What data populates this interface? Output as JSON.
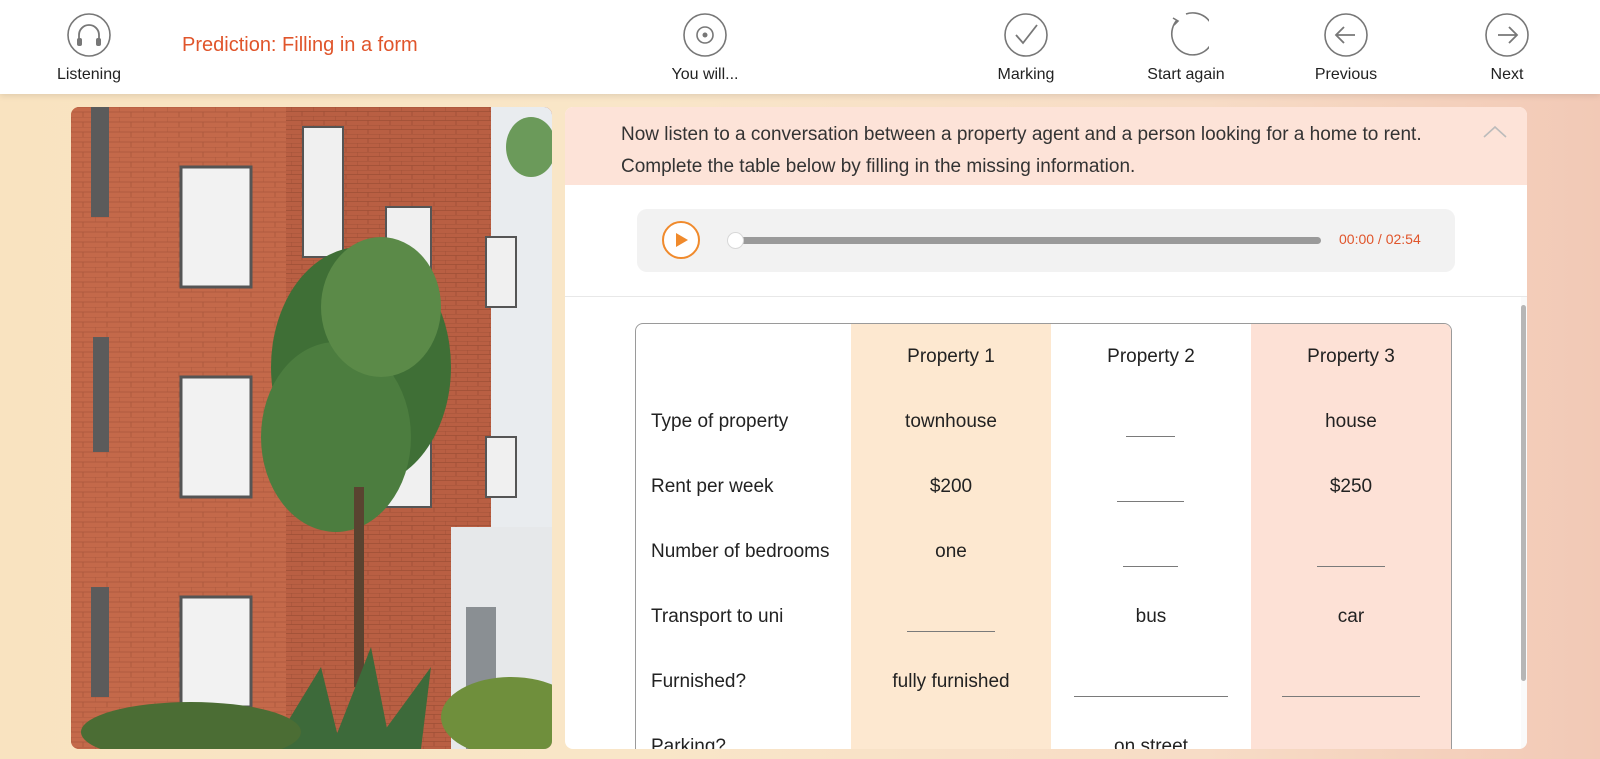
{
  "toolbar": {
    "page_title": "Prediction: Filling in a form",
    "items": [
      {
        "label": "Listening",
        "icon": "headphones-icon"
      },
      {
        "label": "You will...",
        "icon": "target-icon"
      },
      {
        "label": "Marking",
        "icon": "check-icon"
      },
      {
        "label": "Start again",
        "icon": "refresh-icon"
      },
      {
        "label": "Previous",
        "icon": "arrow-left-icon"
      },
      {
        "label": "Next",
        "icon": "arrow-right-icon"
      }
    ]
  },
  "instructions": {
    "text": "Now listen to a conversation between a property agent and a person looking for a home to rent. Complete the table below by filling in the missing information."
  },
  "audio": {
    "time": "00:00 / 02:54",
    "progress": 0
  },
  "table": {
    "headers": [
      "",
      "Property 1",
      "Property 2",
      "Property 3"
    ],
    "rows": [
      {
        "label": "Type of property",
        "cells": [
          "townhouse",
          "",
          "house"
        ]
      },
      {
        "label": "Rent per week",
        "cells": [
          "$200",
          "",
          "$250"
        ]
      },
      {
        "label": "Number of bedrooms",
        "cells": [
          "one",
          "",
          ""
        ]
      },
      {
        "label": "Transport to uni",
        "cells": [
          "",
          "bus",
          "car"
        ]
      },
      {
        "label": "Furnished?",
        "cells": [
          "fully furnished",
          "",
          ""
        ]
      },
      {
        "label": "Parking?",
        "cells": [
          "",
          "on street",
          ""
        ]
      }
    ]
  },
  "colors": {
    "accent": "#e0552b",
    "play": "#f08a2c",
    "property1_bg": "#fde8d0",
    "property3_bg": "#fde1d6",
    "instructions_bg": "#fde3d8"
  }
}
